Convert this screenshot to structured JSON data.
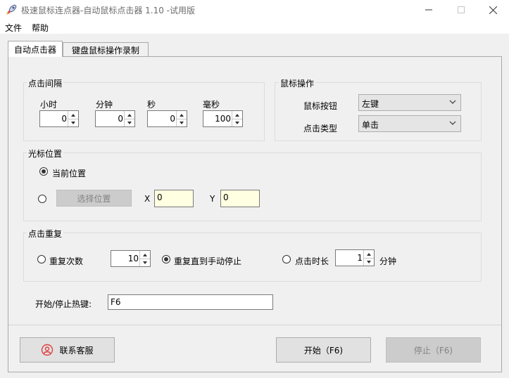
{
  "window": {
    "title": "极速鼠标连点器-自动鼠标点击器 1.10  -试用版",
    "minimize_icon": "minimize-icon",
    "maximize_icon": "maximize-icon",
    "close_icon": "close-icon"
  },
  "menu": {
    "file": "文件",
    "help": "帮助"
  },
  "tabs": [
    {
      "label": "自动点击器",
      "active": true
    },
    {
      "label": "键盘鼠标操作录制",
      "active": false
    }
  ],
  "interval": {
    "title": "点击间隔",
    "hours_label": "小时",
    "hours_value": "0",
    "minutes_label": "分钟",
    "minutes_value": "0",
    "seconds_label": "秒",
    "seconds_value": "0",
    "ms_label": "毫秒",
    "ms_value": "100"
  },
  "mouse_op": {
    "title": "鼠标操作",
    "button_label": "鼠标按钮",
    "button_value": "左键",
    "click_type_label": "点击类型",
    "click_type_value": "单击"
  },
  "cursor": {
    "title": "光标位置",
    "current_label": "当前位置",
    "pick_button": "选择位置",
    "x_label": "X",
    "x_value": "0",
    "y_label": "Y",
    "y_value": "0",
    "selected": "current"
  },
  "repeat": {
    "title": "点击重复",
    "count_label": "重复次数",
    "count_value": "10",
    "until_stop_label": "重复直到手动停止",
    "duration_label": "点击时长",
    "duration_value": "1",
    "duration_unit": "分钟",
    "selected": "until_stop"
  },
  "hotkey": {
    "label": "开始/停止热键:",
    "value": "F6"
  },
  "buttons": {
    "contact": "联系客服",
    "start": "开始（F6)",
    "stop": "停止（F6)"
  },
  "colors": {
    "input_highlight": "#ffffe1",
    "accent_red": "#e04040"
  }
}
